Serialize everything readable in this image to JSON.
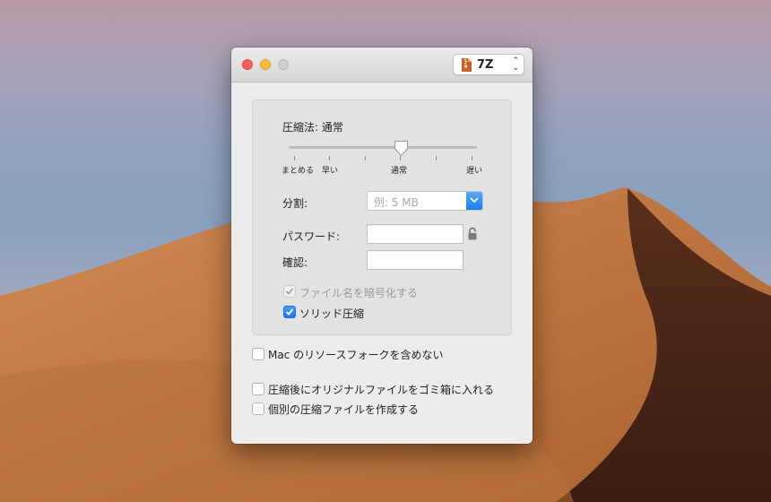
{
  "window": {
    "format": {
      "label": "7Z",
      "icon": "archive-icon"
    }
  },
  "compression": {
    "label": "圧縮法: 通常",
    "level": 0.6,
    "ticks": [
      "まとめる",
      "早い",
      "通常",
      "遅い"
    ]
  },
  "split": {
    "label": "分割:",
    "placeholder": "例: 5 MB"
  },
  "password": {
    "label": "パスワード:",
    "value": ""
  },
  "confirm": {
    "label": "確認:",
    "value": ""
  },
  "options": {
    "encrypt_filenames": {
      "label": "ファイル名を暗号化する",
      "checked": true,
      "enabled": false
    },
    "solid": {
      "label": "ソリッド圧縮",
      "checked": true
    }
  },
  "checkboxes": {
    "exclude_resource_fork": {
      "label": "Mac のリソースフォークを含めない",
      "checked": false
    },
    "trash_after": {
      "label": "圧縮後にオリジナルファイルをゴミ箱に入れる",
      "checked": false
    },
    "separate_archives": {
      "label": "個別の圧縮ファイルを作成する",
      "checked": false
    }
  },
  "colors": {
    "accent": "#1c78ee",
    "close": "#fc605c",
    "minimize": "#fdbc40"
  }
}
